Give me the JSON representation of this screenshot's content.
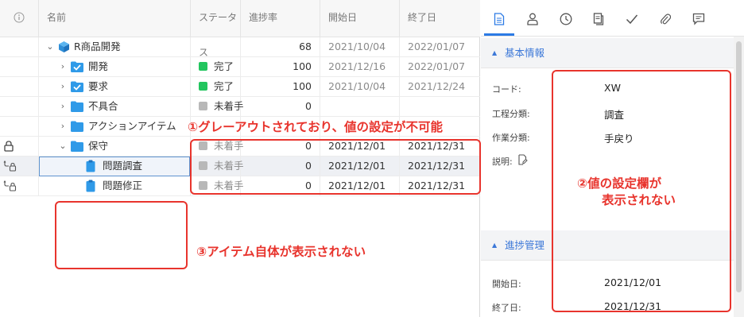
{
  "grid": {
    "columns": [
      "名前",
      "ステータス",
      "進捗率",
      "開始日",
      "終了日"
    ],
    "rows": [
      {
        "name": "R商品開発",
        "status": "",
        "progress": "68",
        "start": "2021/10/04",
        "end": "2022/01/07"
      },
      {
        "name": "開発",
        "status": "完了",
        "progress": "100",
        "start": "2021/12/16",
        "end": "2022/01/07"
      },
      {
        "name": "要求",
        "status": "完了",
        "progress": "100",
        "start": "2021/10/04",
        "end": "2021/12/24"
      },
      {
        "name": "不具合",
        "status": "未着手",
        "progress": "0",
        "start": "",
        "end": ""
      },
      {
        "name": "アクションアイテム",
        "status": "",
        "progress": "",
        "start": "",
        "end": ""
      },
      {
        "name": "保守",
        "status": "未着手",
        "progress": "0",
        "start": "2021/12/01",
        "end": "2021/12/31"
      },
      {
        "name": "問題調査",
        "status": "未着手",
        "progress": "0",
        "start": "2021/12/01",
        "end": "2021/12/31"
      },
      {
        "name": "問題修正",
        "status": "未着手",
        "progress": "0",
        "start": "2021/12/01",
        "end": "2021/12/31"
      }
    ]
  },
  "panel": {
    "section_basic": "基本情報",
    "section_progress": "進捗管理",
    "fields": [
      {
        "label": "コード:",
        "value": "XW"
      },
      {
        "label": "工程分類:",
        "value": "調査"
      },
      {
        "label": "作業分類:",
        "value": "手戻り"
      },
      {
        "label": "説明:",
        "value": ""
      }
    ],
    "progress_fields": [
      {
        "label": "開始日:",
        "value": "2021/12/01"
      },
      {
        "label": "終了日:",
        "value": "2021/12/31"
      }
    ]
  },
  "annotations": {
    "note1": "①グレーアウトされており、値の設定が不可能",
    "note2_line1": "②値の設定欄が",
    "note2_line2": "表示されない",
    "note3": "③アイテム自体が表示されない"
  },
  "colors": {
    "done": "#22c55e",
    "notstarted": "#b8b8b8",
    "folder": "#2f9ae8",
    "accent": "#2c7be5",
    "annotation": "#e8342d"
  }
}
